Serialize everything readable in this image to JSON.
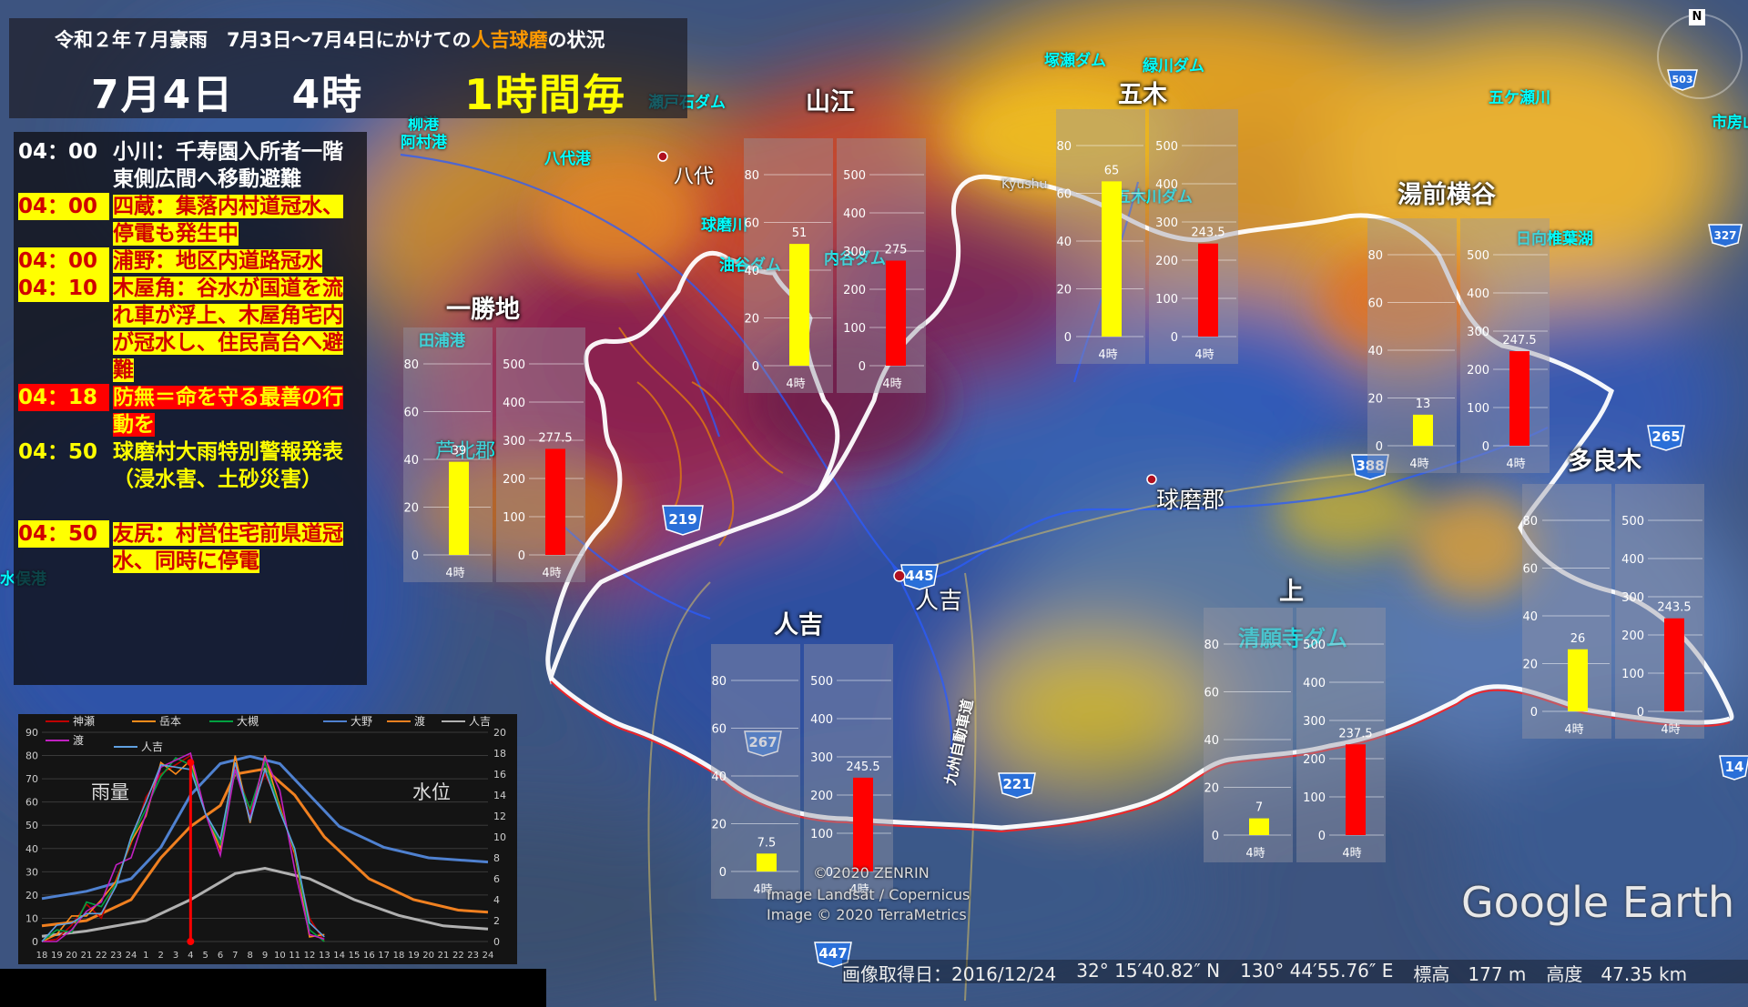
{
  "header": {
    "title_prefix": "令和２年７月豪雨　7月3日～7月4日にかけての",
    "title_highlight": "人吉球磨",
    "title_suffix": "の状況",
    "date": "7月4日",
    "hour": "4時",
    "interval": "1時間毎"
  },
  "events": [
    {
      "time": "04：00",
      "text": "小川：千寿園入所者一階東側広間へ移動避難",
      "style": "plain"
    },
    {
      "time": "04：00",
      "text": "四蔵：集落内村道冠水、停電も発生中",
      "style": "yellowbg"
    },
    {
      "time": "04：00",
      "text": "浦野：地区内道路冠水",
      "style": "yellowbg"
    },
    {
      "time": "04：10",
      "text": "木屋角：谷水が国道を流れ車が浮上、木屋角宅内が冠水し、住民高台へ避難",
      "style": "yellowbg"
    },
    {
      "time": "04：18",
      "text": "防無＝命を守る最善の行動を",
      "style": "redbg"
    },
    {
      "time": "04：50",
      "text": "球磨村大雨特別警報発表（浸水害、土砂災害）",
      "style": "yellow"
    },
    {
      "time": "04：50",
      "text": "友尻：村営住宅前県道冠水、同時に停電",
      "style": "yellowbg"
    }
  ],
  "stations": [
    {
      "name": "一勝地",
      "rain": 39,
      "level": 277.5,
      "rain_label": "39",
      "level_label": "277.5",
      "x_label": "4時"
    },
    {
      "name": "山江",
      "rain": 51,
      "level": 275,
      "rain_label": "51",
      "level_label": "275",
      "x_label": "4時"
    },
    {
      "name": "五木",
      "rain": 65,
      "level": 243.5,
      "rain_label": "65",
      "level_label": "243.5",
      "x_label": "4時"
    },
    {
      "name": "湯前横谷",
      "rain": 13,
      "level": 247.5,
      "rain_label": "13",
      "level_label": "247.5",
      "x_label": "4時"
    },
    {
      "name": "多良木",
      "rain": 26,
      "level": 243.5,
      "rain_label": "26",
      "level_label": "243.5",
      "x_label": "4時"
    },
    {
      "name": "上",
      "rain": 7,
      "level": 237.5,
      "rain_label": "7",
      "level_label": "237.5",
      "x_label": "4時"
    },
    {
      "name": "人吉",
      "rain": 7.5,
      "level": 245.5,
      "rain_label": "7.5",
      "level_label": "245.5",
      "x_label": "4時"
    }
  ],
  "mini_chart": {
    "rain_ticks": [
      "0",
      "20",
      "40",
      "60",
      "80"
    ],
    "level_ticks": [
      "0",
      "100",
      "200",
      "300",
      "400",
      "500"
    ],
    "rain_max": 80,
    "level_max": 500,
    "rain_color": "#ffff00",
    "level_color": "#ff0000"
  },
  "hydrograph": {
    "rain_label": "雨量",
    "level_label": "水位",
    "left_ticks": [
      "0",
      "10",
      "20",
      "30",
      "40",
      "50",
      "60",
      "70",
      "80",
      "90"
    ],
    "right_ticks": [
      "0",
      "2",
      "4",
      "6",
      "8",
      "10",
      "12",
      "14",
      "16",
      "18",
      "20"
    ],
    "x_ticks": [
      "18",
      "19",
      "20",
      "21",
      "22",
      "23",
      "24",
      "1",
      "2",
      "3",
      "4",
      "5",
      "6",
      "7",
      "8",
      "9",
      "10",
      "11",
      "12",
      "13",
      "14",
      "15",
      "16",
      "17",
      "18",
      "19",
      "20",
      "21",
      "22",
      "23",
      "24"
    ],
    "legend": [
      {
        "name": "神瀬",
        "color": "#c00000"
      },
      {
        "name": "岳本",
        "color": "#ff8c1a"
      },
      {
        "name": "大槻",
        "color": "#00a040"
      },
      {
        "name": "大野",
        "color": "#4f81d0"
      },
      {
        "name": "渡",
        "color": "#f08020"
      },
      {
        "name": "人吉",
        "color": "#b0b0b0"
      },
      {
        "name": "渡",
        "color": "#c020c0"
      },
      {
        "name": "人吉",
        "color": "#60a0e0"
      }
    ],
    "current_index": 10,
    "current_value": 77
  },
  "map_labels": {
    "places": [
      {
        "text": "八代",
        "color": "#ffffff"
      },
      {
        "text": "人吉",
        "color": "#ffffff"
      },
      {
        "text": "球磨郡",
        "color": "#ffffff"
      },
      {
        "text": "芦北郡",
        "color": "#00ffff"
      }
    ],
    "features": [
      "八代港",
      "柳港",
      "阿村港",
      "球磨川",
      "油谷ダム",
      "内谷ダム",
      "瀬戸石ダム",
      "塚瀬ダム",
      "緑川ダム",
      "五木川ダム",
      "市房山",
      "清願寺ダム",
      "五ケ瀬川",
      "日向椎葉湖",
      "田浦港",
      "水俣港",
      "九州自動車道",
      "Kyushu"
    ],
    "route_numbers": [
      "219",
      "445",
      "388",
      "265",
      "267",
      "221",
      "447",
      "327",
      "503",
      "14"
    ]
  },
  "credits": {
    "zenrin": "© 2020 ZENRIN",
    "landsat": "Image Landsat / Copernicus",
    "terrametrics": "Image © 2020 TerraMetrics",
    "google_earth": "Google Earth"
  },
  "status_bar": {
    "date": "画像取得日：2016/12/24",
    "lat": "32° 15′40.82″ N",
    "lon": "130° 44′55.76″ E",
    "elev": "標高　177 m",
    "alt": "高度　47.35 km"
  },
  "colors": {
    "boundary": "#ffffff",
    "accent_orange": "#ff9900",
    "accent_yellow": "#ffff00",
    "accent_red": "#ff0000"
  }
}
